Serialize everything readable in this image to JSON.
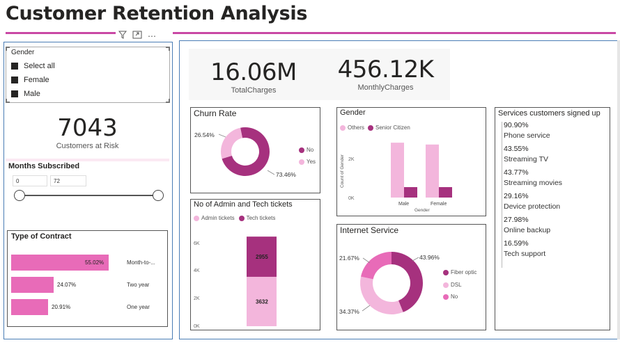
{
  "page": {
    "title": "Customer Retention Analysis"
  },
  "colors": {
    "accent": "#c948a5",
    "dark": "#a6317e",
    "light": "#f3b6dc",
    "bar": "#e86bb8"
  },
  "gender_slicer": {
    "title": "Gender",
    "options": [
      "Select all",
      "Female",
      "Male"
    ]
  },
  "customers_at_risk": {
    "value": "7043",
    "label": "Customers at Risk"
  },
  "months_subscribed": {
    "title": "Months Subscribed",
    "min": "0",
    "max": "72"
  },
  "contract": {
    "title": "Type of Contract",
    "rows": [
      {
        "label": "Month-to-...",
        "value": "55.02%",
        "fraction": 0.5502
      },
      {
        "label": "Two year",
        "value": "24.07%",
        "fraction": 0.2407
      },
      {
        "label": "One year",
        "value": "20.91%",
        "fraction": 0.2091
      }
    ]
  },
  "total_charges": {
    "value": "16.06M",
    "label": "TotalCharges"
  },
  "monthly_charges": {
    "value": "456.12K",
    "label": "MonthlyCharges"
  },
  "churn": {
    "title": "Churn Rate",
    "legend": [
      "No",
      "Yes"
    ],
    "no_pct": "73.46%",
    "yes_pct": "26.54%",
    "no_fraction": 0.7346
  },
  "gender_chart": {
    "title": "Gender",
    "legend": [
      "Others",
      "Senior Citizen"
    ],
    "xlabel": "Gender",
    "ylabel": "Count of Gender",
    "yticks": [
      "2K",
      "0K"
    ],
    "categories": [
      "Male",
      "Female"
    ],
    "others": [
      3000,
      2900
    ],
    "senior": [
      570,
      570
    ],
    "ymax": 3500
  },
  "tickets": {
    "title": "No of Admin and Tech tickets",
    "legend": [
      "Admin tickets",
      "Tech tickets"
    ],
    "yticks": [
      "6K",
      "4K",
      "2K",
      "0K"
    ],
    "admin": "3632",
    "tech": "2955",
    "admin_value": 3632,
    "tech_value": 2955,
    "ymax": 6800
  },
  "internet": {
    "title": "Internet Service",
    "legend": [
      "Fiber optic",
      "DSL",
      "No"
    ],
    "fiber_pct": "43.96%",
    "dsl_pct": "34.37%",
    "no_pct": "21.67%",
    "fractions": [
      0.4396,
      0.3437,
      0.2167
    ]
  },
  "services": {
    "title": "Services customers signed up",
    "items": [
      {
        "pct": "90.90%",
        "name": "Phone service"
      },
      {
        "pct": "43.55%",
        "name": "Streaming TV"
      },
      {
        "pct": "43.77%",
        "name": "Streaming movies"
      },
      {
        "pct": "29.16%",
        "name": "Device protection"
      },
      {
        "pct": "27.98%",
        "name": "Online backup"
      },
      {
        "pct": "16.59%",
        "name": "Tech support"
      }
    ]
  }
}
